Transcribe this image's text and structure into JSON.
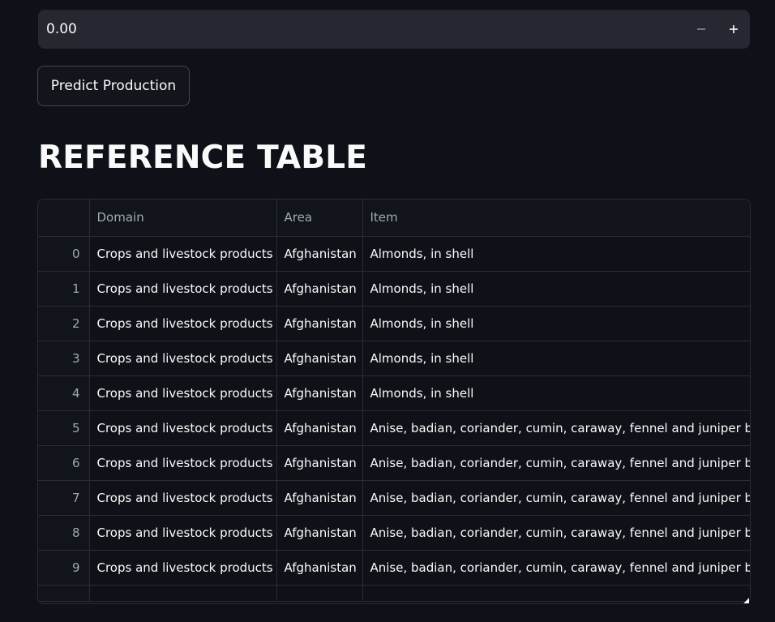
{
  "number_input": {
    "value": "0.00",
    "minus_label": "−",
    "plus_label": "+"
  },
  "predict_button": {
    "label": "Predict Production"
  },
  "heading": "REFERENCE TABLE",
  "table": {
    "columns": [
      "",
      "Domain",
      "Area",
      "Item"
    ],
    "rows": [
      {
        "index": "0",
        "domain": "Crops and livestock products",
        "area": "Afghanistan",
        "item": "Almonds, in shell"
      },
      {
        "index": "1",
        "domain": "Crops and livestock products",
        "area": "Afghanistan",
        "item": "Almonds, in shell"
      },
      {
        "index": "2",
        "domain": "Crops and livestock products",
        "area": "Afghanistan",
        "item": "Almonds, in shell"
      },
      {
        "index": "3",
        "domain": "Crops and livestock products",
        "area": "Afghanistan",
        "item": "Almonds, in shell"
      },
      {
        "index": "4",
        "domain": "Crops and livestock products",
        "area": "Afghanistan",
        "item": "Almonds, in shell"
      },
      {
        "index": "5",
        "domain": "Crops and livestock products",
        "area": "Afghanistan",
        "item": "Anise, badian, coriander, cumin, caraway, fennel and juniper be"
      },
      {
        "index": "6",
        "domain": "Crops and livestock products",
        "area": "Afghanistan",
        "item": "Anise, badian, coriander, cumin, caraway, fennel and juniper be"
      },
      {
        "index": "7",
        "domain": "Crops and livestock products",
        "area": "Afghanistan",
        "item": "Anise, badian, coriander, cumin, caraway, fennel and juniper be"
      },
      {
        "index": "8",
        "domain": "Crops and livestock products",
        "area": "Afghanistan",
        "item": "Anise, badian, coriander, cumin, caraway, fennel and juniper be"
      },
      {
        "index": "9",
        "domain": "Crops and livestock products",
        "area": "Afghanistan",
        "item": "Anise, badian, coriander, cumin, caraway, fennel and juniper be"
      }
    ]
  },
  "colors": {
    "background": "#0e1117",
    "input_bg": "#262730",
    "border": "#2a2d36",
    "text": "#fafafa",
    "muted": "#a3a8b4"
  }
}
